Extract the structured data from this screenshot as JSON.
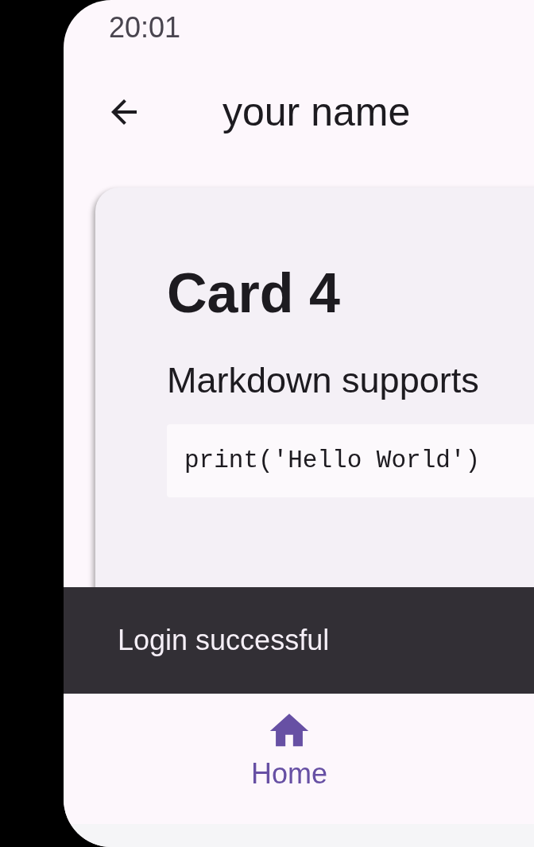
{
  "status_bar": {
    "time": "20:01"
  },
  "app_bar": {
    "title": "your name"
  },
  "card": {
    "title": "Card 4",
    "text": "Markdown supports",
    "code": "print('Hello World')"
  },
  "snackbar": {
    "message": "Login successful"
  },
  "nav_bar": {
    "items": [
      {
        "label": "Home",
        "selected": true
      }
    ]
  }
}
